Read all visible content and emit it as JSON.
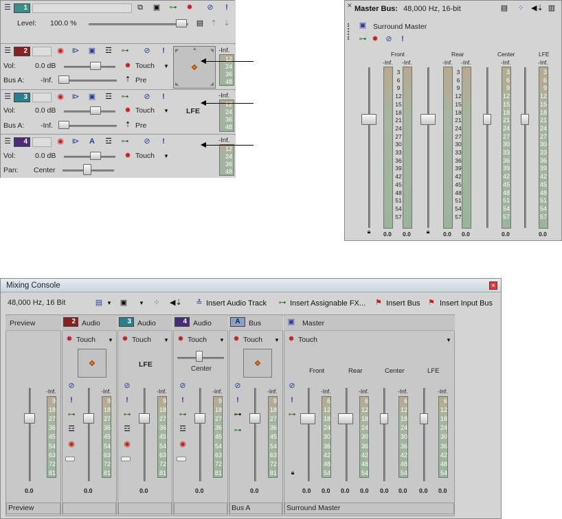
{
  "top_left": {
    "master_track": {
      "number": "1",
      "level_label": "Level:",
      "level_value": "100.0 %"
    },
    "tracks": [
      {
        "number": "2",
        "vol_label": "Vol:",
        "vol_value": "0.0 dB",
        "mode": "Touch",
        "row2_label": "Bus A:",
        "row2_value": "-Inf.",
        "row2_mode": "Pre",
        "meter_top": "-Inf.",
        "meter_ticks": [
          "12",
          "24",
          "36",
          "48"
        ]
      },
      {
        "number": "3",
        "vol_label": "Vol:",
        "vol_value": "0.0 dB",
        "mode": "Touch",
        "row2_label": "Bus A:",
        "row2_value": "-Inf.",
        "row2_mode": "Pre",
        "panner_label": "LFE",
        "meter_top": "-Inf.",
        "meter_ticks": [
          "12",
          "24",
          "36",
          "48"
        ]
      },
      {
        "number": "4",
        "vol_label": "Vol:",
        "vol_value": "0.0 dB",
        "mode": "Touch",
        "row2_label": "Pan:",
        "row2_value": "Center",
        "meter_top": "-Inf.",
        "meter_ticks": [
          "12",
          "24",
          "36",
          "48"
        ]
      }
    ]
  },
  "master_bus": {
    "title": "Master Bus:",
    "format": "48,000 Hz, 16-bit",
    "subtitle": "Surround Master",
    "channels": [
      "Front",
      "Rear",
      "Center",
      "LFE"
    ],
    "inf": "-Inf.",
    "zero": "0.0",
    "scale": [
      "3",
      "6",
      "9",
      "12",
      "15",
      "18",
      "21",
      "24",
      "27",
      "30",
      "33",
      "36",
      "39",
      "42",
      "45",
      "48",
      "51",
      "54",
      "57"
    ],
    "scale_short": [
      "3",
      "6",
      "9",
      "12",
      "15",
      "18",
      "21",
      "24",
      "27",
      "30",
      "33",
      "36",
      "39",
      "42",
      "45",
      "48",
      "51",
      "54",
      "57"
    ]
  },
  "console": {
    "title": "Mixing Console",
    "close": "×",
    "format": "48,000 Hz, 16 Bit",
    "toolbar": {
      "insert_audio_track": "Insert Audio Track",
      "insert_fx": "Insert Assignable FX...",
      "insert_bus": "Insert Bus",
      "insert_input_bus": "Insert Input Bus"
    },
    "strips": [
      {
        "header": "Preview",
        "footer": "Preview",
        "value": "0.0"
      },
      {
        "num": "2",
        "header": "Audio",
        "mode": "Touch",
        "value": "0.0",
        "footer": ""
      },
      {
        "num": "3",
        "header": "Audio",
        "mode": "Touch",
        "panner_label": "LFE",
        "value": "0.0",
        "footer": ""
      },
      {
        "num": "4",
        "header": "Audio",
        "mode": "Touch",
        "pan_label": "Center",
        "value": "0.0",
        "footer": ""
      },
      {
        "num": "A",
        "header": "Bus",
        "mode": "Touch",
        "value": "0.0",
        "footer": "Bus A"
      },
      {
        "header": "Master",
        "mode": "Touch",
        "footer": "Surround Master"
      }
    ],
    "master_channels": [
      "Front",
      "Rear",
      "Center",
      "LFE"
    ],
    "inf": "-Inf.",
    "scale_a": [
      "9",
      "18",
      "27",
      "36",
      "45",
      "54",
      "63",
      "72",
      "81"
    ],
    "scale_b": [
      "6",
      "12",
      "18",
      "24",
      "30",
      "36",
      "42",
      "48",
      "54"
    ],
    "zeros": [
      "0.0",
      "0.0",
      "0.0",
      "0.0",
      "0.0",
      "0.0",
      "0.0",
      "0.0"
    ]
  }
}
